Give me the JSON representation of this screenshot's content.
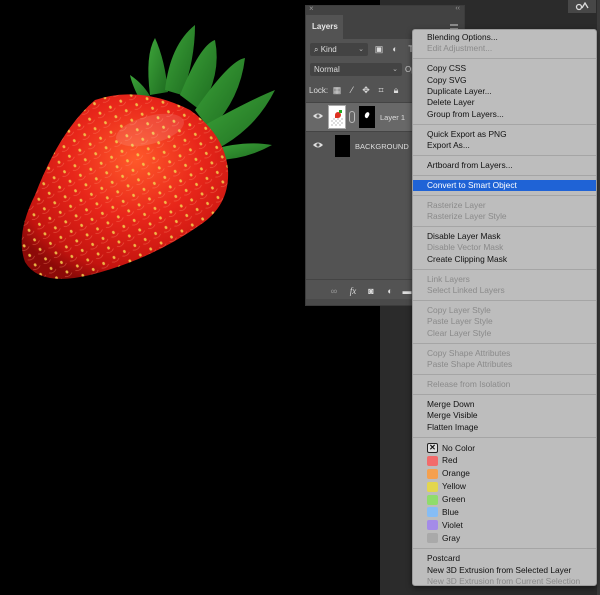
{
  "canvas": {
    "background_color": "#000000",
    "image_subject": "strawberry"
  },
  "layers_panel": {
    "tab_label": "Layers",
    "close_glyph": "×",
    "collapse_glyph": "‹‹",
    "filter": {
      "kind_label": "Kind",
      "search_glyph": "⌕",
      "chevron_glyph": "⌄",
      "icons": [
        "image-filter-icon",
        "adjustment-filter-icon",
        "type-filter-icon"
      ]
    },
    "blend_mode": "Normal",
    "opacity_label": "Opa",
    "lock_label": "Lock:",
    "layers": [
      {
        "name": "Layer 1",
        "selected": true,
        "visible": true,
        "has_mask": true
      },
      {
        "name": "BACKGROUND",
        "selected": false,
        "visible": true,
        "has_mask": false
      }
    ],
    "footer_icons": [
      "link-icon",
      "fx-icon",
      "add-mask-icon",
      "adjustment-layer-icon",
      "group-folder-icon"
    ],
    "footer_glyphs": {
      "link": "∞",
      "fx": "fx",
      "mask": "◙",
      "adjust": "◐",
      "folder": "▬"
    }
  },
  "context_menu": {
    "groups": [
      [
        {
          "label": "Blending Options...",
          "enabled": true
        },
        {
          "label": "Edit Adjustment...",
          "enabled": false
        }
      ],
      [
        {
          "label": "Copy CSS",
          "enabled": true
        },
        {
          "label": "Copy SVG",
          "enabled": true
        },
        {
          "label": "Duplicate Layer...",
          "enabled": true
        },
        {
          "label": "Delete Layer",
          "enabled": true
        },
        {
          "label": "Group from Layers...",
          "enabled": true
        }
      ],
      [
        {
          "label": "Quick Export as PNG",
          "enabled": true
        },
        {
          "label": "Export As...",
          "enabled": true
        }
      ],
      [
        {
          "label": "Artboard from Layers...",
          "enabled": true
        }
      ],
      [
        {
          "label": "Convert to Smart Object",
          "enabled": true,
          "highlighted": true
        }
      ],
      [
        {
          "label": "Rasterize Layer",
          "enabled": false
        },
        {
          "label": "Rasterize Layer Style",
          "enabled": false
        }
      ],
      [
        {
          "label": "Disable Layer Mask",
          "enabled": true
        },
        {
          "label": "Disable Vector Mask",
          "enabled": false
        },
        {
          "label": "Create Clipping Mask",
          "enabled": true
        }
      ],
      [
        {
          "label": "Link Layers",
          "enabled": false
        },
        {
          "label": "Select Linked Layers",
          "enabled": false
        }
      ],
      [
        {
          "label": "Copy Layer Style",
          "enabled": false
        },
        {
          "label": "Paste Layer Style",
          "enabled": false
        },
        {
          "label": "Clear Layer Style",
          "enabled": false
        }
      ],
      [
        {
          "label": "Copy Shape Attributes",
          "enabled": false
        },
        {
          "label": "Paste Shape Attributes",
          "enabled": false
        }
      ],
      [
        {
          "label": "Release from Isolation",
          "enabled": false
        }
      ],
      [
        {
          "label": "Merge Down",
          "enabled": true
        },
        {
          "label": "Merge Visible",
          "enabled": true
        },
        {
          "label": "Flatten Image",
          "enabled": true
        }
      ]
    ],
    "colors": [
      {
        "label": "No Color",
        "swatch": "none",
        "glyph": "✕"
      },
      {
        "label": "Red",
        "swatch": "#f26b6b"
      },
      {
        "label": "Orange",
        "swatch": "#f5a04e"
      },
      {
        "label": "Yellow",
        "swatch": "#e3d64d"
      },
      {
        "label": "Green",
        "swatch": "#8fdc6c"
      },
      {
        "label": "Blue",
        "swatch": "#86bdf5"
      },
      {
        "label": "Violet",
        "swatch": "#a48be8"
      },
      {
        "label": "Gray",
        "swatch": "#a9a9a9"
      }
    ],
    "footer_items": [
      {
        "label": "Postcard",
        "enabled": true
      },
      {
        "label": "New 3D Extrusion from Selected Layer",
        "enabled": true
      },
      {
        "label": "New 3D Extrusion from Current Selection",
        "enabled": false
      }
    ],
    "highlight_color": "#1f63d6"
  }
}
